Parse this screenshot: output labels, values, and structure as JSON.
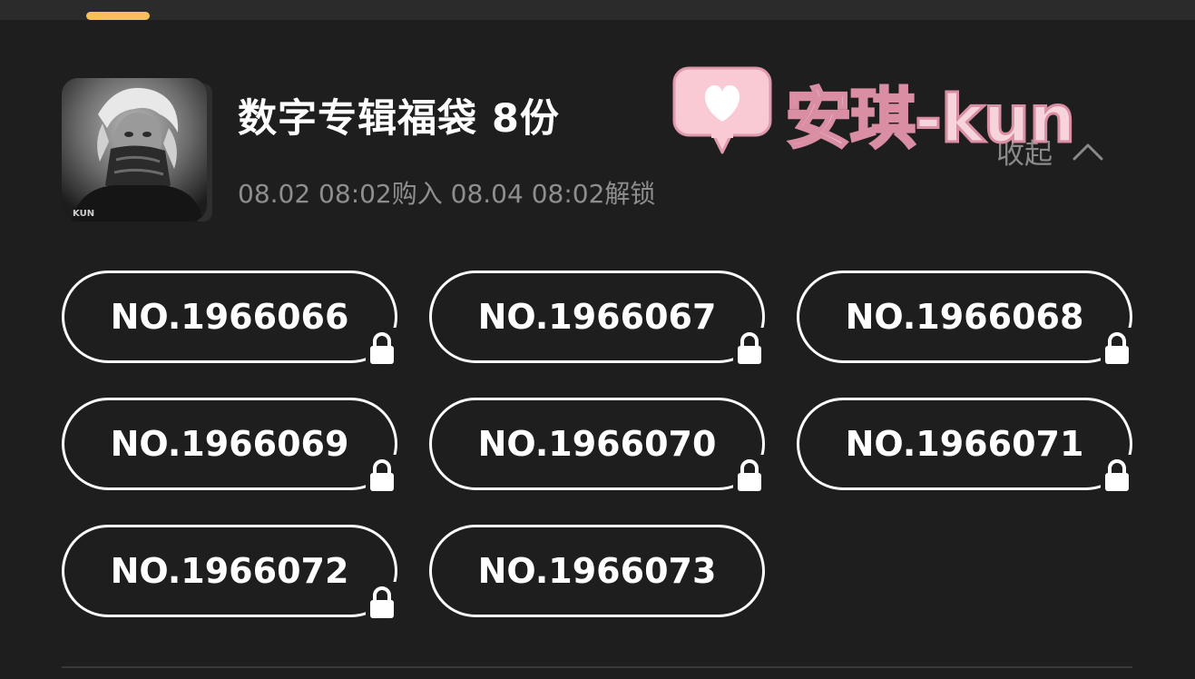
{
  "package": {
    "title": "数字专辑福袋 8份",
    "purchase_info": "08.02 08:02购入 08.04 08:02解锁",
    "collapse_label": "收起",
    "cover_icon": "album-cover-image"
  },
  "watermark": {
    "text": "安琪-kun",
    "icon": "heart-speech-bubble-icon"
  },
  "serials": [
    {
      "label": "NO.1966066",
      "locked": true
    },
    {
      "label": "NO.1966067",
      "locked": true
    },
    {
      "label": "NO.1966068",
      "locked": true
    },
    {
      "label": "NO.1966069",
      "locked": true
    },
    {
      "label": "NO.1966070",
      "locked": true
    },
    {
      "label": "NO.1966071",
      "locked": true
    },
    {
      "label": "NO.1966072",
      "locked": true
    },
    {
      "label": "NO.1966073",
      "locked": false
    }
  ],
  "colors": {
    "background": "#1e1e1e",
    "accent_tab": "#f4c05a",
    "text_primary": "#ffffff",
    "text_secondary": "#8e8e8e",
    "watermark_pink": "#f7d3dc"
  }
}
